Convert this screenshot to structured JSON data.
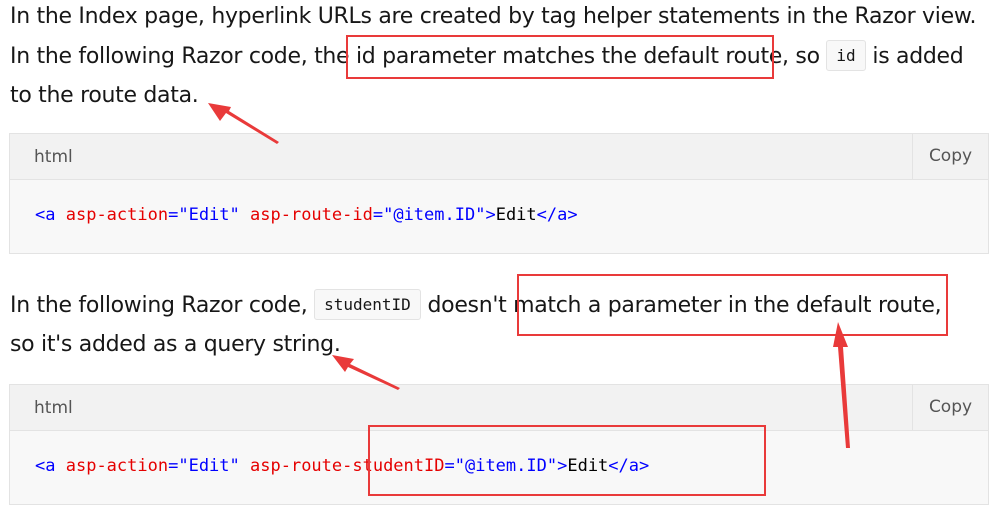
{
  "paragraph1": {
    "line1": "In the Index page, hyperlink URLs are created by tag helper statements in the Razor view.",
    "line2_pre": "In the following Razor code, the ",
    "line2_highlight": "id parameter matches the default route",
    "line2_mid": ", so ",
    "code": "id",
    "line2_post": " is added",
    "line3": "to the route data."
  },
  "code_block_1": {
    "lang": "html",
    "copy_label": "Copy",
    "tokens": [
      "<a",
      " ",
      "asp-action",
      "=",
      "\"Edit\"",
      " ",
      "asp-route-id",
      "=",
      "\"@item.ID\"",
      ">",
      "Edit",
      "</a>"
    ]
  },
  "paragraph2": {
    "pre": "In the following Razor code, ",
    "code": "studentID",
    "mid": " doesn't ",
    "highlight": "match a parameter in the default route,",
    "line2": "so it's added as a query string."
  },
  "code_block_2": {
    "lang": "html",
    "copy_label": "Copy",
    "tokens": [
      "<a",
      " ",
      "asp-action",
      "=",
      "\"Edit\"",
      " ",
      "asp-route-studentID",
      "=",
      "\"@item.ID\"",
      ">",
      "Edit",
      "</a>"
    ]
  },
  "annotation_color": "#e93a3a"
}
